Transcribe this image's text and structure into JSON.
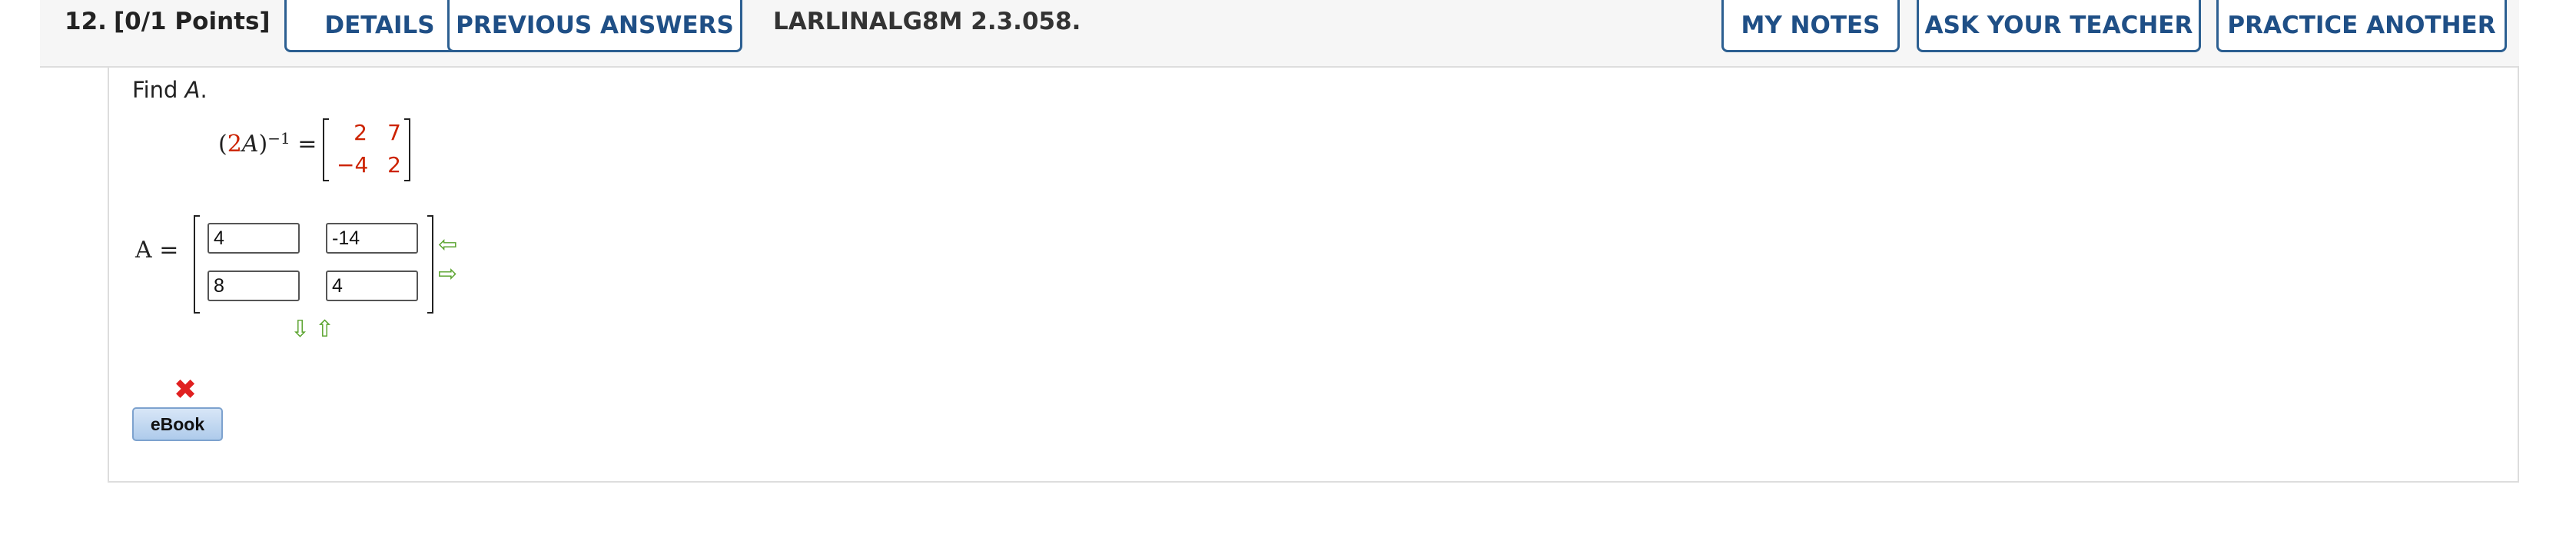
{
  "question": {
    "number": "12.",
    "points": "[0/1 Points]",
    "code": "LARLINALG8M 2.3.058."
  },
  "buttons": {
    "details": "DETAILS",
    "previous_answers": "PREVIOUS ANSWERS",
    "my_notes": "MY NOTES",
    "ask_teacher": "ASK YOUR TEACHER",
    "practice_another": "PRACTICE ANOTHER",
    "ebook": "eBook"
  },
  "prompt": {
    "find": "Find",
    "var": "A",
    "period": "."
  },
  "given": {
    "open": "(",
    "coef": "2",
    "var": "A",
    "close": ")",
    "exp": "−1",
    "eq": " =",
    "matrix": [
      [
        "2",
        "7"
      ],
      [
        "−4",
        "2"
      ]
    ]
  },
  "answer": {
    "label": "A =",
    "values": [
      [
        "4",
        "-14"
      ],
      [
        "8",
        "4"
      ]
    ]
  },
  "icons": {
    "incorrect": "✖",
    "left_arrow": "⇦",
    "right_arrow": "⇨",
    "down_arrow": "⇩",
    "up_arrow": "⇧"
  },
  "colors": {
    "accent": "#2c5f91",
    "given_values": "#cc2200",
    "arrows": "#5aa32e",
    "incorrect": "#e02020"
  }
}
